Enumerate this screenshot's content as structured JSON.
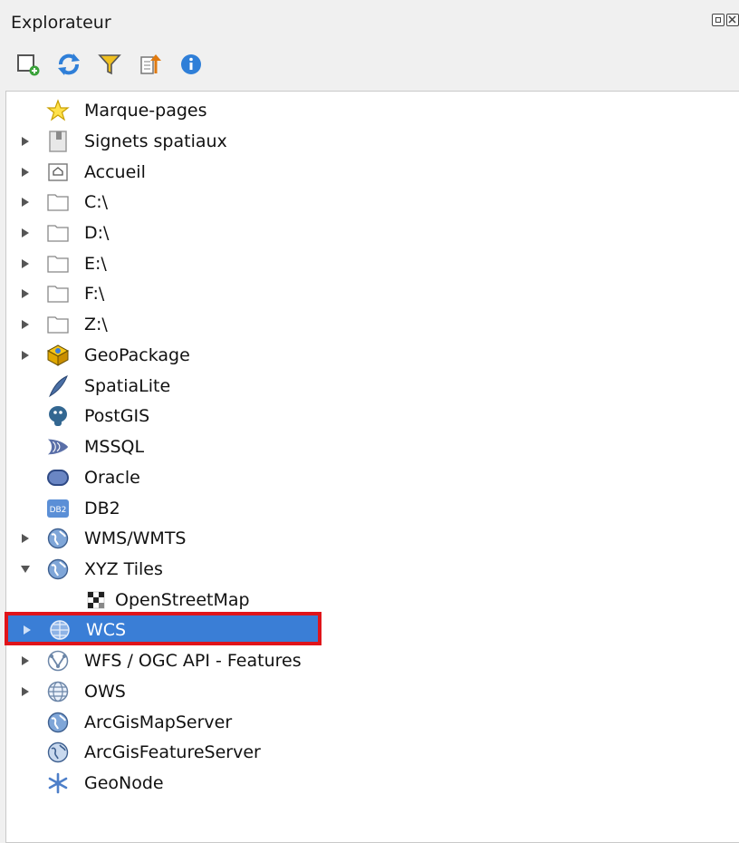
{
  "panel": {
    "title": "Explorateur",
    "window_buttons": [
      "restore-icon",
      "close-icon"
    ]
  },
  "toolbar": {
    "buttons": [
      {
        "name": "add-selected-layers-button",
        "icon": "add-layer-icon"
      },
      {
        "name": "refresh-button",
        "icon": "refresh-icon"
      },
      {
        "name": "filter-button",
        "icon": "filter-icon"
      },
      {
        "name": "collapse-all-button",
        "icon": "collapse-icon"
      },
      {
        "name": "properties-button",
        "icon": "info-icon"
      }
    ]
  },
  "tree": {
    "selected_index": 17,
    "items": [
      {
        "label": "Marque-pages",
        "icon": "star-icon",
        "expander": "none"
      },
      {
        "label": "Signets spatiaux",
        "icon": "spatial-bookmark-icon",
        "expander": "collapsed"
      },
      {
        "label": "Accueil",
        "icon": "home-folder-icon",
        "expander": "collapsed"
      },
      {
        "label": "C:\\",
        "icon": "folder-icon",
        "expander": "collapsed"
      },
      {
        "label": "D:\\",
        "icon": "folder-icon",
        "expander": "collapsed"
      },
      {
        "label": "E:\\",
        "icon": "folder-icon",
        "expander": "collapsed"
      },
      {
        "label": "F:\\",
        "icon": "folder-icon",
        "expander": "collapsed"
      },
      {
        "label": "Z:\\",
        "icon": "folder-icon",
        "expander": "collapsed"
      },
      {
        "label": "GeoPackage",
        "icon": "geopackage-icon",
        "expander": "collapsed"
      },
      {
        "label": "SpatiaLite",
        "icon": "spatialite-icon",
        "expander": "none"
      },
      {
        "label": "PostGIS",
        "icon": "postgis-icon",
        "expander": "none"
      },
      {
        "label": "MSSQL",
        "icon": "mssql-icon",
        "expander": "none"
      },
      {
        "label": "Oracle",
        "icon": "oracle-icon",
        "expander": "none"
      },
      {
        "label": "DB2",
        "icon": "db2-icon",
        "expander": "none"
      },
      {
        "label": "WMS/WMTS",
        "icon": "globe-icon",
        "expander": "collapsed"
      },
      {
        "label": "XYZ Tiles",
        "icon": "globe-icon",
        "expander": "expanded"
      },
      {
        "label": "OpenStreetMap",
        "icon": "xyz-tile-icon",
        "expander": "none",
        "child": true
      },
      {
        "label": "WCS",
        "icon": "wcs-icon",
        "expander": "collapsed"
      },
      {
        "label": "WFS / OGC API - Features",
        "icon": "wfs-icon",
        "expander": "collapsed"
      },
      {
        "label": "OWS",
        "icon": "ows-icon",
        "expander": "collapsed"
      },
      {
        "label": "ArcGisMapServer",
        "icon": "arcgis-map-icon",
        "expander": "none"
      },
      {
        "label": "ArcGisFeatureServer",
        "icon": "arcgis-feature-icon",
        "expander": "none"
      },
      {
        "label": "GeoNode",
        "icon": "geonode-icon",
        "expander": "none"
      }
    ]
  },
  "colors": {
    "selection": "#3a7ed6",
    "highlight_frame": "#e0141a"
  }
}
